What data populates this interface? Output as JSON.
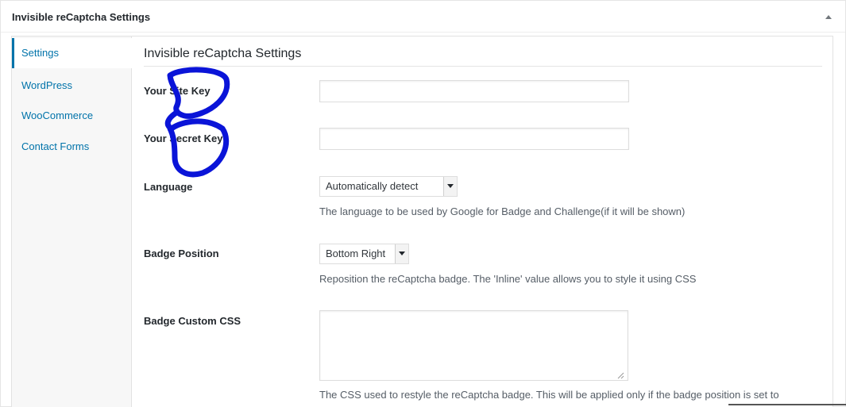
{
  "panel": {
    "title": "Invisible reCaptcha Settings"
  },
  "tabs": [
    {
      "label": "Settings",
      "active": true
    },
    {
      "label": "WordPress",
      "active": false
    },
    {
      "label": "WooCommerce",
      "active": false
    },
    {
      "label": "Contact Forms",
      "active": false
    }
  ],
  "section": {
    "title": "Invisible reCaptcha Settings"
  },
  "fields": {
    "site_key": {
      "label": "Your Site Key",
      "value": "",
      "placeholder": ""
    },
    "secret_key": {
      "label": "Your Secret Key",
      "value": "",
      "placeholder": ""
    },
    "language": {
      "label": "Language",
      "selected": "Automatically detect",
      "description": "The language to be used by Google for Badge and Challenge(if it will be shown)"
    },
    "badge_position": {
      "label": "Badge Position",
      "selected": "Bottom Right",
      "description": "Reposition the reCaptcha badge. The 'Inline' value allows you to style it using CSS"
    },
    "badge_css": {
      "label": "Badge Custom CSS",
      "value": "",
      "description": "The CSS used to restyle the reCaptcha badge. This will be applied only if the badge position is set to"
    }
  },
  "colors": {
    "link": "#0073aa",
    "scribble": "#0a14d8"
  },
  "icons": {
    "toggle": "triangle-up-icon",
    "select_arrow": "chevron-down-icon"
  }
}
